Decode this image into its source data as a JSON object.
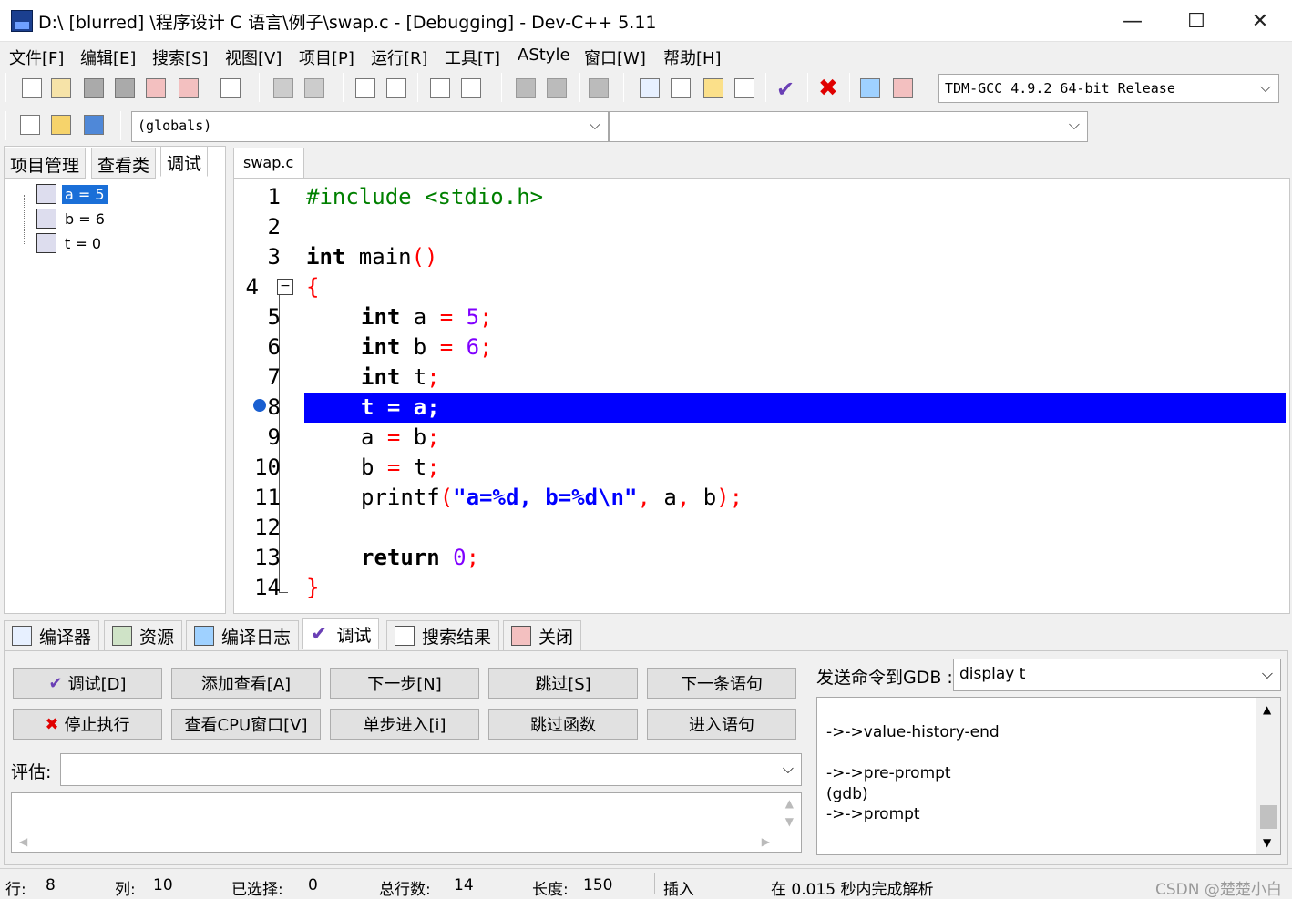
{
  "window": {
    "title": "D:\\ [blurred] \\程序设计 C 语言\\例子\\swap.c - [Debugging] - Dev-C++ 5.11",
    "minimize": "—",
    "maximize": "☐",
    "close": "✕"
  },
  "menu": [
    "文件[F]",
    "编辑[E]",
    "搜索[S]",
    "视图[V]",
    "项目[P]",
    "运行[R]",
    "工具[T]",
    "AStyle",
    "窗口[W]",
    "帮助[H]"
  ],
  "toolbar": {
    "compiler": "TDM-GCC 4.9.2 64-bit Release",
    "scope": "(globals)",
    "member": ""
  },
  "left_tabs": [
    "项目管理",
    "查看类",
    "调试"
  ],
  "watches": [
    {
      "label": "a = 5",
      "selected": true
    },
    {
      "label": "b = 6",
      "selected": false
    },
    {
      "label": "t = 0",
      "selected": false
    }
  ],
  "editor": {
    "file_tab": "swap.c",
    "current_line": 8,
    "lines": [
      "1",
      "2",
      "3",
      "4",
      "5",
      "6",
      "7",
      "8",
      "9",
      "10",
      "11",
      "12",
      "13",
      "14"
    ],
    "code": {
      "l1_pp": "#include <stdio.h>",
      "l3_kw": "int",
      "l3_rest": " main",
      "l3_sym": "()",
      "l4_sym": "{",
      "l5_kw": "int",
      "l5_rest": " a ",
      "l5_eq": "=",
      "l5_num": "5",
      "l5_semi": ";",
      "l6_kw": "int",
      "l6_rest": " b ",
      "l6_eq": "=",
      "l6_num": "6",
      "l6_semi": ";",
      "l7_kw": "int",
      "l7_rest": " t",
      "l7_semi": ";",
      "l8": "t = a;",
      "l9_a": "a ",
      "l9_eq": "=",
      "l9_b": " b",
      "l9_semi": ";",
      "l10_a": "b ",
      "l10_eq": "=",
      "l10_b": " t",
      "l10_semi": ";",
      "l11_fn": "printf",
      "l11_p": "(",
      "l11_str": "\"a=%d, b=%d\\n\"",
      "l11_c1": ",",
      "l11_a": " a",
      "l11_c2": ",",
      "l11_b": " b",
      "l11_end": ");",
      "l13_kw": "return",
      "l13_num": "0",
      "l13_semi": ";",
      "l14_sym": "}"
    }
  },
  "bottom_tabs": [
    "编译器",
    "资源",
    "编译日志",
    "调试",
    "搜索结果",
    "关闭"
  ],
  "debug_buttons": {
    "debug": "调试[D]",
    "add_watch": "添加查看[A]",
    "next_step": "下一步[N]",
    "skip": "跳过[S]",
    "next_statement": "下一条语句",
    "stop": "停止执行",
    "cpu_window": "查看CPU窗口[V]",
    "step_into": "单步进入[i]",
    "skip_function": "跳过函数",
    "into_statement": "进入语句"
  },
  "evaluate": {
    "label": "评估:",
    "value": ""
  },
  "gdb": {
    "label": "发送命令到GDB :",
    "command": "display t",
    "output": [
      "->->value-history-end",
      "",
      "->->pre-prompt",
      "(gdb)",
      "->->prompt"
    ]
  },
  "status": {
    "row_label": "行:",
    "row": "8",
    "col_label": "列:",
    "col": "10",
    "sel_label": "已选择:",
    "sel": "0",
    "lines_label": "总行数:",
    "lines": "14",
    "len_label": "长度:",
    "len": "150",
    "mode": "插入",
    "parse": "在 0.015 秒内完成解析",
    "watermark": "CSDN @楚楚小白"
  },
  "colors": {
    "highlight": "#0000ff",
    "keyword": "#000000",
    "preprocessor": "#008000",
    "symbol": "#ff0000",
    "number": "#8000ff",
    "string": "#0000ff"
  }
}
